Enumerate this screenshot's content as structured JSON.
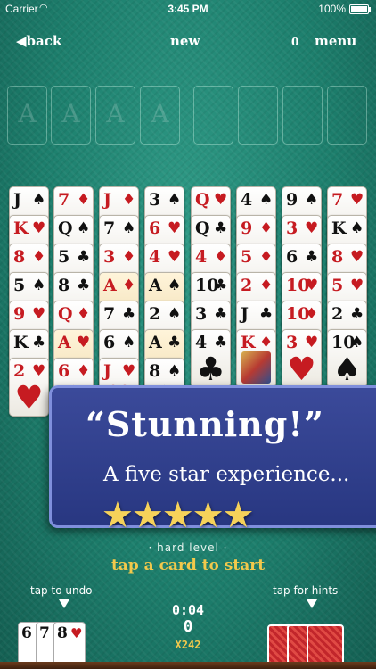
{
  "status_bar": {
    "carrier": "Carrier",
    "time": "3:45 PM",
    "battery": "100%"
  },
  "top_bar": {
    "back": "back",
    "new": "new",
    "count": "0",
    "menu": "menu"
  },
  "foundation": {
    "ghost_label": "A"
  },
  "tableau": [
    [
      {
        "rank": "J",
        "suit": "♠",
        "color": "black"
      },
      {
        "rank": "K",
        "suit": "♥",
        "color": "red"
      },
      {
        "rank": "8",
        "suit": "♦",
        "color": "red"
      },
      {
        "rank": "5",
        "suit": "♠",
        "color": "black"
      },
      {
        "rank": "9",
        "suit": "♥",
        "color": "red"
      },
      {
        "rank": "K",
        "suit": "♣",
        "color": "black"
      },
      {
        "rank": "2",
        "suit": "♥",
        "color": "red"
      }
    ],
    [
      {
        "rank": "7",
        "suit": "♦",
        "color": "red"
      },
      {
        "rank": "Q",
        "suit": "♠",
        "color": "black"
      },
      {
        "rank": "5",
        "suit": "♣",
        "color": "black"
      },
      {
        "rank": "8",
        "suit": "♣",
        "color": "black"
      },
      {
        "rank": "Q",
        "suit": "♦",
        "color": "red"
      },
      {
        "rank": "A",
        "suit": "♥",
        "color": "red",
        "highlight": true
      },
      {
        "rank": "6",
        "suit": "♦",
        "color": "red"
      }
    ],
    [
      {
        "rank": "J",
        "suit": "♦",
        "color": "red"
      },
      {
        "rank": "7",
        "suit": "♠",
        "color": "black"
      },
      {
        "rank": "3",
        "suit": "♦",
        "color": "red"
      },
      {
        "rank": "A",
        "suit": "♦",
        "color": "red",
        "highlight": true
      },
      {
        "rank": "7",
        "suit": "♣",
        "color": "black"
      },
      {
        "rank": "6",
        "suit": "♠",
        "color": "black"
      },
      {
        "rank": "J",
        "suit": "♥",
        "color": "red"
      }
    ],
    [
      {
        "rank": "3",
        "suit": "♠",
        "color": "black"
      },
      {
        "rank": "6",
        "suit": "♥",
        "color": "red"
      },
      {
        "rank": "4",
        "suit": "♥",
        "color": "red"
      },
      {
        "rank": "A",
        "suit": "♠",
        "color": "black",
        "highlight": true
      },
      {
        "rank": "2",
        "suit": "♠",
        "color": "black"
      },
      {
        "rank": "A",
        "suit": "♣",
        "color": "black",
        "highlight": true
      },
      {
        "rank": "8",
        "suit": "♠",
        "color": "black"
      }
    ],
    [
      {
        "rank": "Q",
        "suit": "♥",
        "color": "red"
      },
      {
        "rank": "Q",
        "suit": "♣",
        "color": "black"
      },
      {
        "rank": "4",
        "suit": "♦",
        "color": "red"
      },
      {
        "rank": "10",
        "suit": "♣",
        "color": "black"
      },
      {
        "rank": "3",
        "suit": "♣",
        "color": "black"
      },
      {
        "rank": "4",
        "suit": "♣",
        "color": "black"
      }
    ],
    [
      {
        "rank": "4",
        "suit": "♠",
        "color": "black"
      },
      {
        "rank": "9",
        "suit": "♦",
        "color": "red"
      },
      {
        "rank": "5",
        "suit": "♦",
        "color": "red"
      },
      {
        "rank": "2",
        "suit": "♦",
        "color": "red"
      },
      {
        "rank": "J",
        "suit": "♣",
        "color": "black"
      },
      {
        "rank": "K",
        "suit": "♦",
        "color": "red",
        "face": true
      }
    ],
    [
      {
        "rank": "9",
        "suit": "♠",
        "color": "black"
      },
      {
        "rank": "3",
        "suit": "♥",
        "color": "red"
      },
      {
        "rank": "6",
        "suit": "♣",
        "color": "black"
      },
      {
        "rank": "10",
        "suit": "♥",
        "color": "red"
      },
      {
        "rank": "10",
        "suit": "♦",
        "color": "red"
      },
      {
        "rank": "3",
        "suit": "♥",
        "color": "red"
      }
    ],
    [
      {
        "rank": "7",
        "suit": "♥",
        "color": "red"
      },
      {
        "rank": "K",
        "suit": "♠",
        "color": "black"
      },
      {
        "rank": "8",
        "suit": "♥",
        "color": "red"
      },
      {
        "rank": "5",
        "suit": "♥",
        "color": "red"
      },
      {
        "rank": "2",
        "suit": "♣",
        "color": "black"
      },
      {
        "rank": "10",
        "suit": "♠",
        "color": "black"
      }
    ]
  ],
  "promo": {
    "quote": "“Stunning!”",
    "subtitle": "A five star experience...",
    "stars": 5
  },
  "level": "· hard level ·",
  "start_prompt": "tap a card to start",
  "undo_label": "tap to undo",
  "hints_label": "tap for hints",
  "timer": "0:04",
  "moves": "0",
  "multiplier": "X242",
  "undo_cards": [
    {
      "rank": "6",
      "suit": ""
    },
    {
      "rank": "7",
      "suit": ""
    },
    {
      "rank": "8",
      "suit": "♥"
    }
  ]
}
